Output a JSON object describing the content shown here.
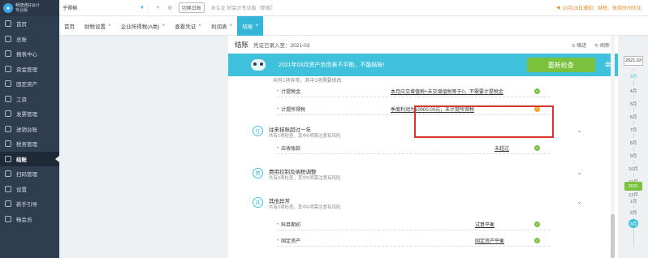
{
  "sidebar": {
    "logo_text": "畅捷通好会计",
    "logo_sub": "专业版",
    "items": [
      {
        "label": "首页"
      },
      {
        "label": "总账"
      },
      {
        "label": "报表中心"
      },
      {
        "label": "资金管理"
      },
      {
        "label": "固定资产"
      },
      {
        "label": "工资"
      },
      {
        "label": "发票管理"
      },
      {
        "label": "进销台账"
      },
      {
        "label": "税务管理"
      },
      {
        "label": "结账"
      },
      {
        "label": "扫码管理"
      },
      {
        "label": "设置"
      },
      {
        "label": "新手引导"
      },
      {
        "label": "畅会员"
      }
    ]
  },
  "topbar": {
    "account": "于得楠",
    "switch_label": "切换日账",
    "cert_text": "未认证 好会计专业版（新版）",
    "notice": "10月26日通知：财税、账务时间优化"
  },
  "tabs": [
    {
      "label": "首页"
    },
    {
      "label": "财税设置"
    },
    {
      "label": "企业所得税(A类)"
    },
    {
      "label": "查看凭证"
    },
    {
      "label": "利润表"
    },
    {
      "label": "结账"
    }
  ],
  "panel": {
    "title": "结账",
    "subtitle": "凭证已录入至：2021-03",
    "tool1": "缩进",
    "tool2": "刷新",
    "banner_text": "2021年03月资产负债表不平衡，不能结账!",
    "recheck_label": "重新检查",
    "partial_text": "共有1项异常，其中1项需要修改",
    "rows": [
      {
        "label": "计提税金",
        "desc": "本月应交增值税+未交增值税等于0，不需要计提税金",
        "status": "✓"
      },
      {
        "label": "计提所得税",
        "desc": "季度利润为10000.00元，未计提所得税",
        "status": "!"
      },
      {
        "label": "应收账款",
        "desc": "未超过",
        "status": "✓"
      },
      {
        "label": "科目期初",
        "desc": "试算平衡",
        "status": "✓"
      },
      {
        "label": "固定资产",
        "desc": "固定资产平衡",
        "status": "✓"
      }
    ],
    "sections": [
      {
        "title": "往来挂账超过一年",
        "sub": "共有1项检查，其中0项需注意有风险",
        "icon": "往"
      },
      {
        "title": "费用控制及纳税调整",
        "sub": "共有0项检查，其中0项需注意有风险",
        "icon": "费"
      },
      {
        "title": "其他异常",
        "sub": "共有0项检查，其中0项需注意有风险",
        "icon": "其"
      }
    ]
  },
  "timeline": {
    "year_select": "2021.03",
    "months": [
      "3月",
      "4月",
      "5月",
      "6月",
      "7月",
      "8月",
      "9月",
      "10月",
      "11月",
      "12月"
    ],
    "year_marker": "2021",
    "months2": [
      "1月",
      "2月"
    ],
    "current": "3月"
  },
  "colors": {
    "accent": "#3fc1dc",
    "sidebar": "#2e3d4f",
    "ok": "#7ac23e",
    "warn": "#f2a52a",
    "highlight": "#d9352b"
  }
}
